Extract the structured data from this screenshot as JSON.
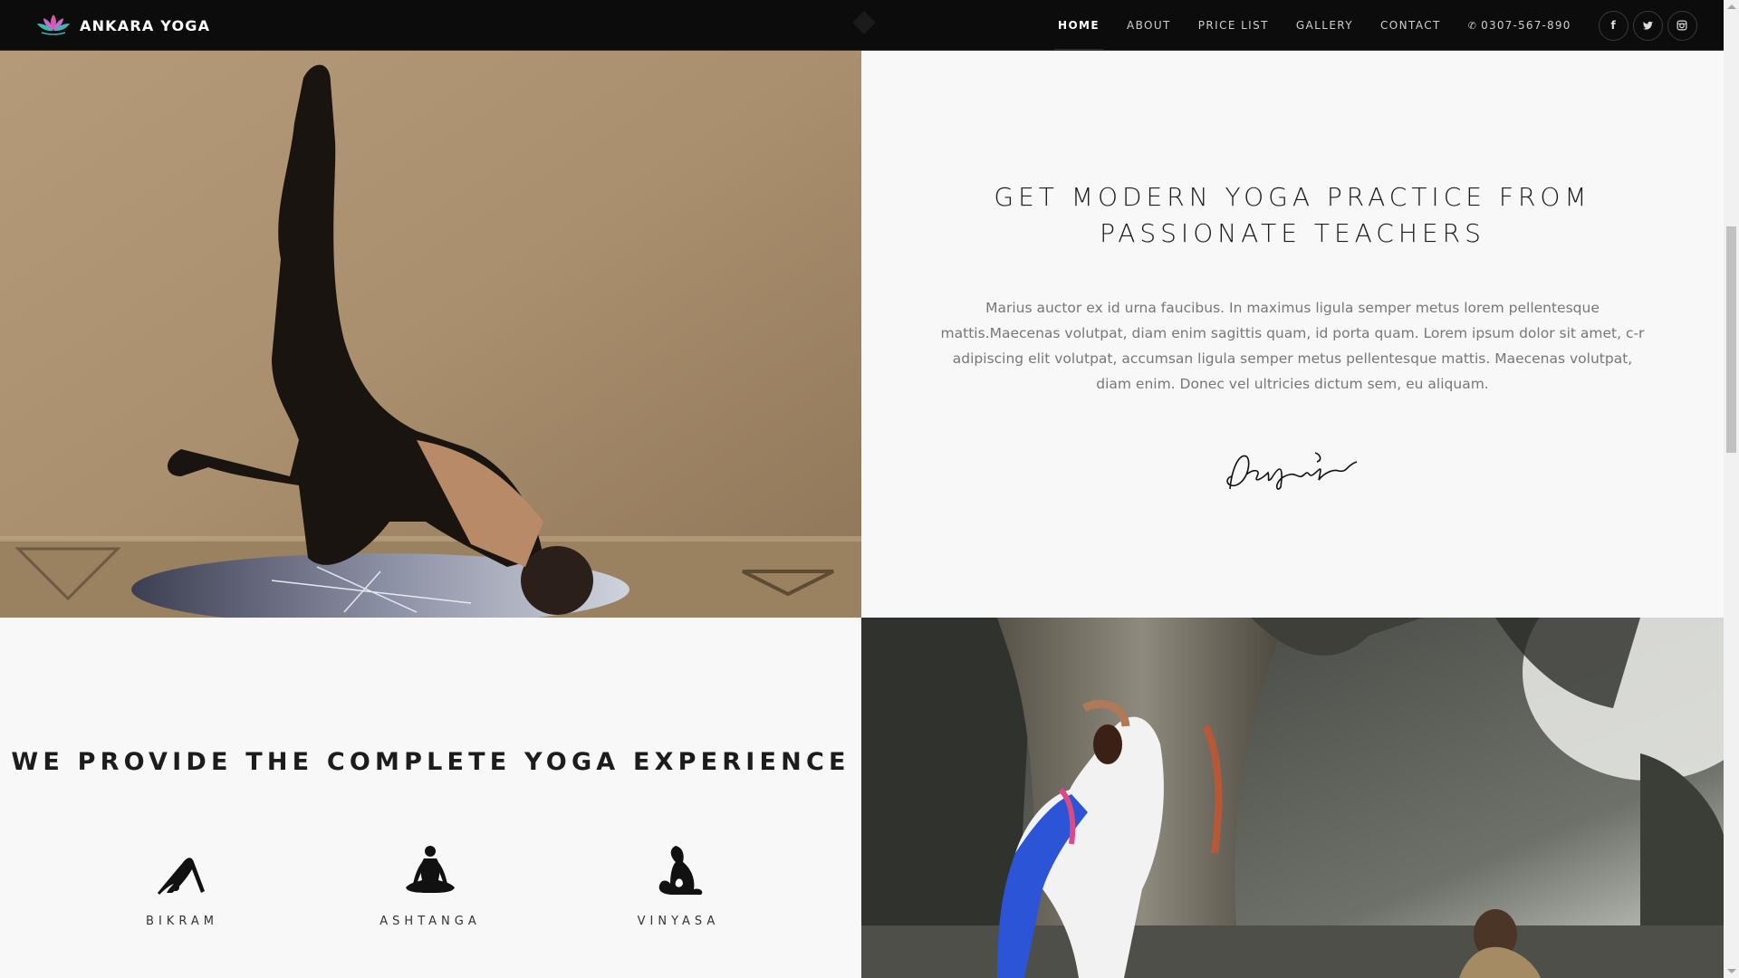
{
  "brand": {
    "name": "ANKARA YOGA",
    "logo_icon": "lotus-icon"
  },
  "nav": {
    "links": [
      {
        "label": "HOME",
        "active": true
      },
      {
        "label": "ABOUT"
      },
      {
        "label": "PRICE LIST"
      },
      {
        "label": "GALLERY"
      },
      {
        "label": "CONTACT"
      }
    ],
    "phone_icon": "phone-icon",
    "phone": "0307-567-890",
    "socials": [
      {
        "icon": "facebook-icon",
        "glyph": "f"
      },
      {
        "icon": "twitter-icon",
        "glyph": "t"
      },
      {
        "icon": "instagram-icon",
        "glyph": "◎"
      }
    ]
  },
  "section_one": {
    "image": "man-yoga-handstand-photo",
    "heading": "GET MODERN YOGA PRACTICE FROM PASSIONATE TEACHERS",
    "paragraph": "Marius auctor ex id urna faucibus. In maximus ligula semper metus lorem pellentesque mattis.Maecenas volutpat, diam enim sagittis quam, id porta quam. Lorem ipsum dolor sit amet, c-r adipiscing elit volutpat, accumsan ligula semper metus pellentesque mattis. Maecenas volutpat, diam enim. Donec vel ultricies dictum sem, eu aliquam.",
    "signature": "signature-graphic"
  },
  "section_two": {
    "heading": "WE PROVIDE THE COMPLETE YOGA EXPERIENCE",
    "styles": [
      {
        "label": "BIKRAM",
        "icon": "downward-dog-pose-icon"
      },
      {
        "label": "ASHTANGA",
        "icon": "lotus-meditation-pose-icon"
      },
      {
        "label": "VINYASA",
        "icon": "king-pigeon-pose-icon"
      }
    ],
    "image": "woman-yoga-under-tree-photo"
  },
  "colors": {
    "navbar_bg": "#0c0c0c",
    "page_bg": "#f8f8f8",
    "heading_text": "#1c1c1c",
    "body_text": "#777777",
    "accent_blue": "#2b55d6"
  }
}
